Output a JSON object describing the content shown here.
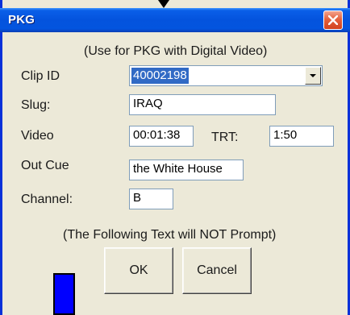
{
  "window": {
    "title": "PKG",
    "close_icon": "close-x-icon"
  },
  "dialog": {
    "instruction_top": "(Use for PKG with Digital Video)",
    "instruction_bottom": "(The Following Text will NOT Prompt)"
  },
  "fields": {
    "clip_id": {
      "label": "Clip ID",
      "value": "40002198"
    },
    "slug": {
      "label": "Slug:",
      "value": "IRAQ"
    },
    "video": {
      "label": "Video",
      "value": "00:01:38"
    },
    "trt": {
      "label": "TRT:",
      "value": "1:50"
    },
    "out_cue": {
      "label": "Out Cue",
      "value": "the White House"
    },
    "channel": {
      "label": "Channel:",
      "value": "B"
    }
  },
  "buttons": {
    "ok_label": "OK",
    "cancel_label": "Cancel"
  },
  "colors": {
    "title_bar": "#0453dd",
    "window_border": "#0831d9",
    "dialog_bg": "#ece9d8",
    "selection": "#316ac5",
    "overlay_bar": "#0000ff"
  }
}
